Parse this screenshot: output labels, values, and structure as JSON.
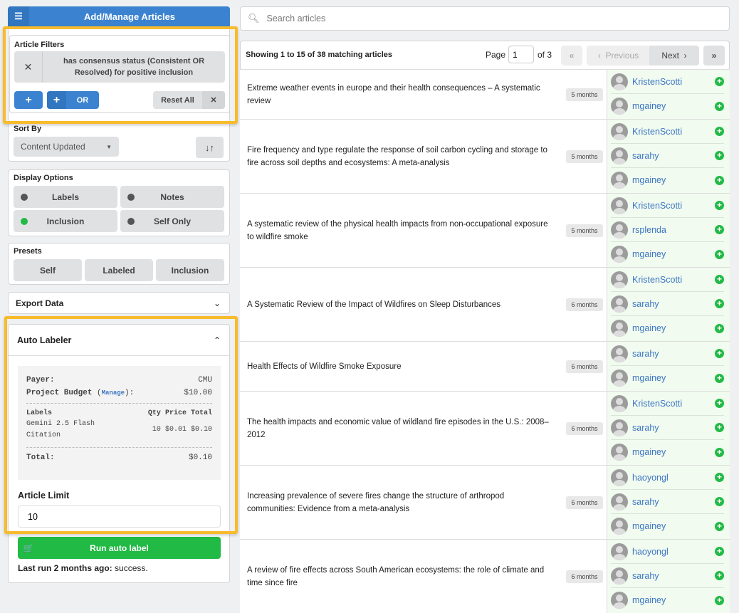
{
  "header": {
    "title": "Add/Manage Articles"
  },
  "filters": {
    "label": "Article Filters",
    "filter_text": "has consensus status (Consistent OR Resolved) for positive inclusion",
    "or_label": "OR",
    "reset_label": "Reset All"
  },
  "sort": {
    "label": "Sort By",
    "value": "Content Updated"
  },
  "display": {
    "label": "Display Options",
    "labels": "Labels",
    "notes": "Notes",
    "inclusion": "Inclusion",
    "self_only": "Self Only"
  },
  "presets": {
    "label": "Presets",
    "items": [
      "Self",
      "Labeled",
      "Inclusion"
    ]
  },
  "export": {
    "label": "Export Data"
  },
  "auto": {
    "label": "Auto Labeler",
    "payer_label": "Payer:",
    "payer": "CMU",
    "budget_label": "Project Budget",
    "manage": "Manage",
    "budget": "$10.00",
    "col_labels": "Labels",
    "col_qty": "Qty",
    "col_price": "Price",
    "col_total": "Total",
    "item": "Gemini 2.5 Flash Citation",
    "qty": "10",
    "price": "$0.01",
    "item_total": "$0.10",
    "total_label": "Total:",
    "total": "$0.10",
    "limit_label": "Article Limit",
    "limit_value": "10",
    "run_label": "Run auto label",
    "last_run_bold": "Last run 2 months ago:",
    "last_run_status": "success."
  },
  "search": {
    "placeholder": "Search articles"
  },
  "list": {
    "showing": "Showing 1 to 15 of 38 matching articles",
    "page_label": "Page",
    "page": "1",
    "of": "of 3",
    "prev": "Previous",
    "next": "Next"
  },
  "articles": [
    {
      "title": "Extreme weather events in europe and their health consequences – A systematic review",
      "age": "5 months",
      "users": [
        "KristenScotti",
        "mgainey"
      ]
    },
    {
      "title": "Fire frequency and type regulate the response of soil carbon cycling and storage to fire across soil depths and ecosystems: A meta-analysis",
      "age": "5 months",
      "users": [
        "KristenScotti",
        "sarahy",
        "mgainey"
      ]
    },
    {
      "title": "A systematic review of the physical health impacts from non-occupational exposure to wildfire smoke",
      "age": "5 months",
      "users": [
        "KristenScotti",
        "rsplenda",
        "mgainey"
      ]
    },
    {
      "title": "A Systematic Review of the Impact of Wildfires on Sleep Disturbances",
      "age": "6 months",
      "users": [
        "KristenScotti",
        "sarahy",
        "mgainey"
      ]
    },
    {
      "title": "Health Effects of Wildfire Smoke Exposure",
      "age": "6 months",
      "users": [
        "sarahy",
        "mgainey"
      ]
    },
    {
      "title": "The health impacts and economic value of wildland fire episodes in the U.S.: 2008–2012",
      "age": "6 months",
      "users": [
        "KristenScotti",
        "sarahy",
        "mgainey"
      ]
    },
    {
      "title": "Increasing prevalence of severe fires change the structure of arthropod communities: Evidence from a meta-analysis",
      "age": "6 months",
      "users": [
        "haoyongl",
        "sarahy",
        "mgainey"
      ]
    },
    {
      "title": "A review of fire effects across South American ecosystems: the role of climate and time since fire",
      "age": "6 months",
      "users": [
        "haoyongl",
        "sarahy",
        "mgainey"
      ]
    }
  ]
}
